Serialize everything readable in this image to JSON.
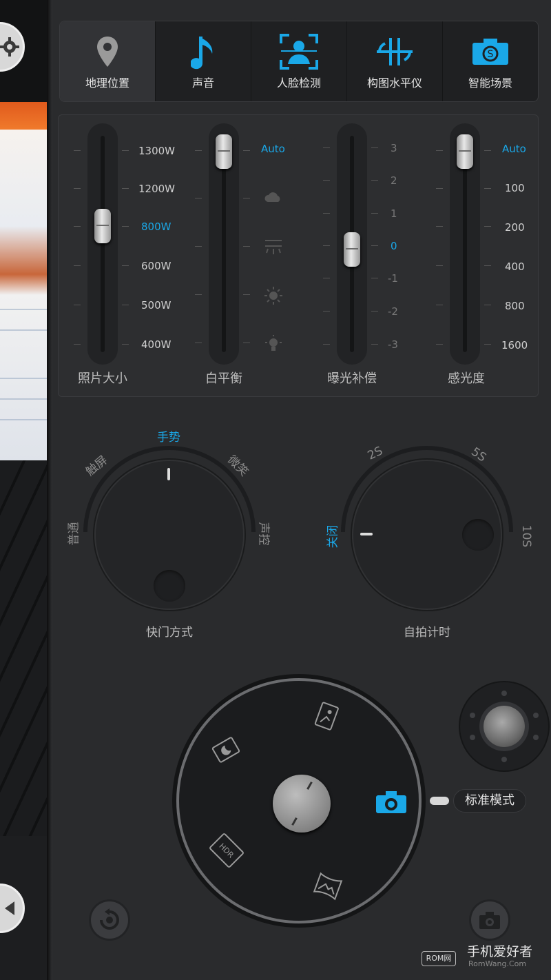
{
  "tabs": [
    {
      "label": "地理位置",
      "icon": "location-pin-icon"
    },
    {
      "label": "声音",
      "icon": "music-note-icon"
    },
    {
      "label": "人脸检测",
      "icon": "face-detect-icon"
    },
    {
      "label": "构图水平仪",
      "icon": "level-icon"
    },
    {
      "label": "智能场景",
      "icon": "smart-scene-camera-icon"
    }
  ],
  "sliders": {
    "photo_size": {
      "title": "照片大小",
      "levels": [
        "1300W",
        "1200W",
        "800W",
        "600W",
        "500W",
        "400W"
      ],
      "selected": "800W"
    },
    "white_balance": {
      "title": "白平衡",
      "levels": [
        "Auto",
        "cloudy",
        "fluorescent",
        "daylight",
        "incandescent"
      ],
      "selected": "Auto"
    },
    "exposure": {
      "title": "曝光补偿",
      "levels": [
        "3",
        "2",
        "1",
        "0",
        "-1",
        "-2",
        "-3"
      ],
      "selected": "0"
    },
    "iso": {
      "title": "感光度",
      "levels": [
        "Auto",
        "100",
        "200",
        "400",
        "800",
        "1600"
      ],
      "selected": "Auto"
    }
  },
  "shutter_dial": {
    "title": "快门方式",
    "options": [
      "普通",
      "触屏",
      "手势",
      "微笑",
      "声控"
    ],
    "selected": "手势"
  },
  "timer_dial": {
    "title": "自拍计时",
    "options": [
      "关闭",
      "2S",
      "5S",
      "10S"
    ],
    "selected": "关闭"
  },
  "mode_wheel": {
    "modes": [
      "night-mode-icon",
      "landscape-mode-icon",
      "camera-mode-icon",
      "panorama-mode-icon",
      "hdr-mode-icon"
    ],
    "selected_label": "标准模式",
    "hdr_text": "HDR"
  },
  "watermark": {
    "cn": "手机爱好者",
    "en": "RomWang.Com",
    "badge": "ROM网"
  },
  "colors": {
    "accent": "#1aa8e8",
    "panel": "#2d2e30",
    "background": "#2a2b2d"
  }
}
